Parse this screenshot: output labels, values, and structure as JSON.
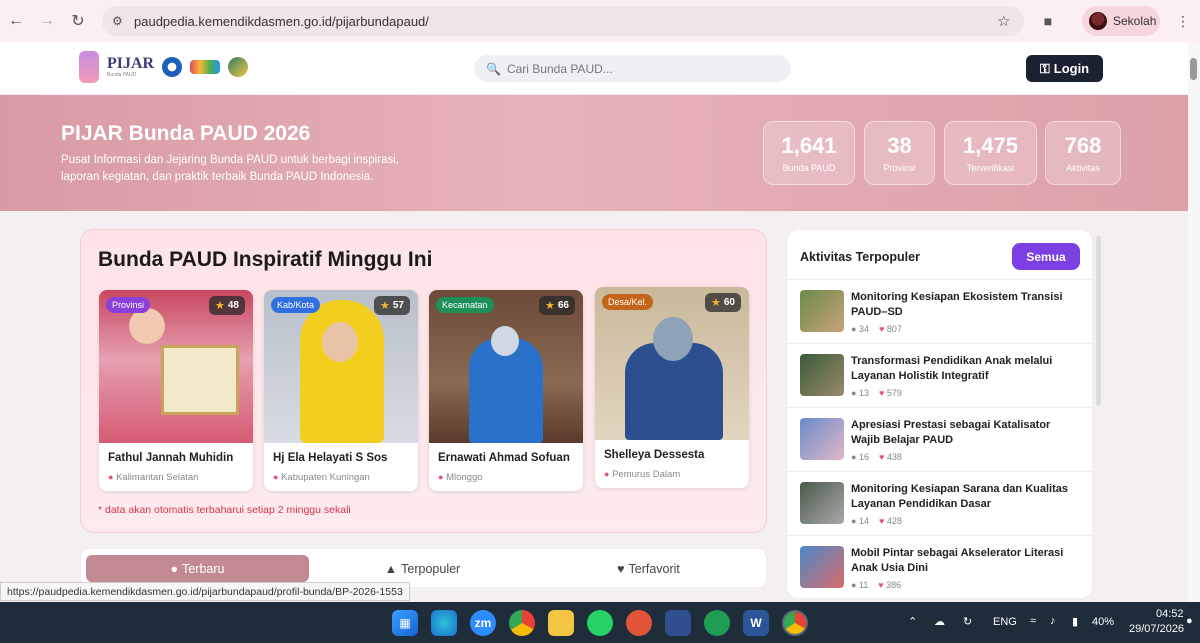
{
  "browser": {
    "url": "paudpedia.kemendikdasmen.go.id/pijarbundapaud/",
    "profile_name": "Sekolah"
  },
  "header": {
    "logo_text": "PIJAR",
    "logo_sub": "Bunda PAUD",
    "search_placeholder": "Cari Bunda PAUD...",
    "login_label": "Login"
  },
  "hero": {
    "title": "PIJAR Bunda PAUD 2026",
    "description": "Pusat Informasi dan Jejaring Bunda PAUD untuk berbagi inspirasi, laporan kegiatan, dan praktik terbaik Bunda PAUD Indonesia.",
    "stats": [
      {
        "value": "1,641",
        "label": "Bunda PAUD"
      },
      {
        "value": "38",
        "label": "Provinsi"
      },
      {
        "value": "1,475",
        "label": "Terverifikasi"
      },
      {
        "value": "768",
        "label": "Aktivitas"
      }
    ]
  },
  "inspiratif": {
    "title": "Bunda PAUD Inspiratif Minggu Ini",
    "note": "* data akan otomatis terbaharui setiap 2 minggu sekali",
    "cards": [
      {
        "badge": "Provinsi",
        "score": "48",
        "name": "Fathul Jannah Muhidin",
        "location": "Kalimantan Selatan"
      },
      {
        "badge": "Kab/Kota",
        "score": "57",
        "name": "Hj Ela Helayati S Sos",
        "location": "Kabupaten Kuningan"
      },
      {
        "badge": "Kecamatan",
        "score": "66",
        "name": "Ernawati Ahmad Sofuan",
        "location": "Mlonggo"
      },
      {
        "badge": "Desa/Kel.",
        "score": "60",
        "name": "Shelleya Dessesta",
        "location": "Pemurus Dalam"
      }
    ]
  },
  "tabs": [
    {
      "label": "Terbaru",
      "icon": "lightbulb-icon"
    },
    {
      "label": "Terpopuler",
      "icon": "fire-icon"
    },
    {
      "label": "Terfavorit",
      "icon": "heart-icon"
    }
  ],
  "aktivitas": {
    "title": "Aktivitas Terpopuler",
    "all_label": "Semua",
    "items": [
      {
        "title": "Monitoring Kesiapan Ekosistem Transisi PAUD–SD",
        "views": "34",
        "likes": "807"
      },
      {
        "title": "Transformasi Pendidikan Anak melalui Layanan Holistik Integratif",
        "views": "13",
        "likes": "579"
      },
      {
        "title": "Apresiasi Prestasi sebagai Katalisator Wajib Belajar PAUD",
        "views": "16",
        "likes": "438"
      },
      {
        "title": "Monitoring Kesiapan Sarana dan Kualitas Layanan Pendidikan Dasar",
        "views": "14",
        "likes": "428"
      },
      {
        "title": "Mobil Pintar sebagai Akselerator Literasi Anak Usia Dini",
        "views": "11",
        "likes": "386"
      }
    ]
  },
  "status_url": "https://paudpedia.kemendikdasmen.go.id/pijarbundapaud/profil-bunda/BP-2026-1553",
  "taskbar": {
    "lang": "ENG",
    "battery": "40%",
    "time": "04:52",
    "date": "29/07/2026"
  },
  "colors": {
    "hero": "#dca1a8",
    "accent_purple": "#7b3fe4",
    "login_dark": "#1b2333",
    "note_red": "#d9324f"
  }
}
